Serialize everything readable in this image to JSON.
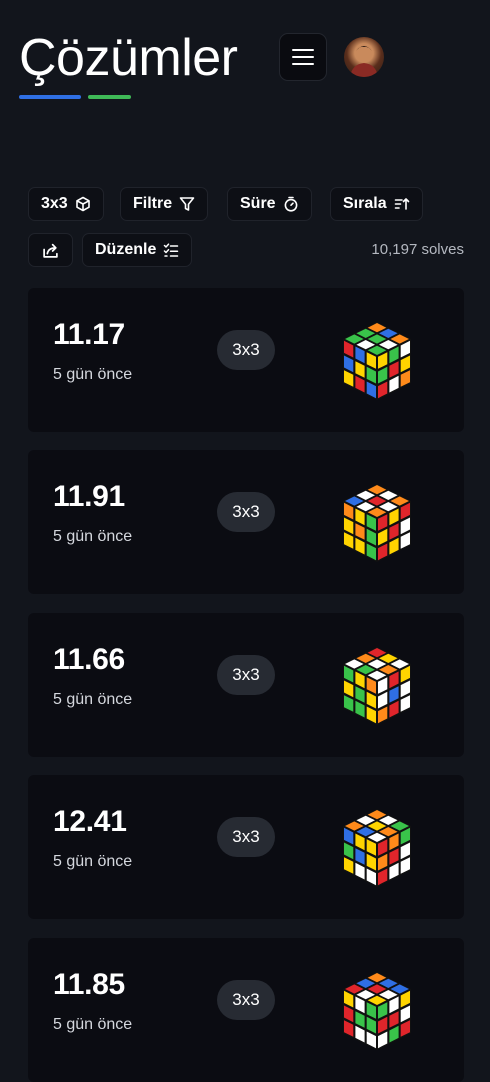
{
  "header": {
    "title": "Çözümler",
    "accent_colors": [
      "#2f6fe4",
      "#3fb957"
    ]
  },
  "toolbar": {
    "puzzle_label": "3x3",
    "filter_label": "Filtre",
    "time_label": "Süre",
    "sort_label": "Sırala",
    "edit_label": "Düzenle",
    "solve_count": "10,197 solves"
  },
  "solves": [
    {
      "time": "11.17",
      "ago": "5 gün önce",
      "puzzle": "3x3",
      "top": [
        "#39c34a",
        "#39c34a",
        "#ff8a1a",
        "#ffffff",
        "#39c34a",
        "#2f6fe4",
        "#39c34a",
        "#ffffff",
        "#ff8a1a"
      ],
      "left": [
        "#e0252b",
        "#2f6fe4",
        "#ffd400",
        "#2f6fe4",
        "#ffd400",
        "#39c34a",
        "#ffd400",
        "#e0252b",
        "#2f6fe4"
      ],
      "right": [
        "#ffd400",
        "#39c34a",
        "#ffffff",
        "#39c34a",
        "#e0252b",
        "#ffd400",
        "#e0252b",
        "#ffffff",
        "#ff8a1a"
      ]
    },
    {
      "time": "11.91",
      "ago": "5 gün önce",
      "puzzle": "3x3",
      "top": [
        "#2f6fe4",
        "#ffffff",
        "#ff8a1a",
        "#ffffff",
        "#e0252b",
        "#ffffff",
        "#ff8a1a",
        "#ffffff",
        "#ff8a1a"
      ],
      "left": [
        "#ff8a1a",
        "#ffd400",
        "#39c34a",
        "#ffd400",
        "#ff8a1a",
        "#39c34a",
        "#ffd400",
        "#ffd400",
        "#39c34a"
      ],
      "right": [
        "#e0252b",
        "#ffd400",
        "#e0252b",
        "#ffd400",
        "#e0252b",
        "#ffffff",
        "#e0252b",
        "#ffd400",
        "#ffffff"
      ]
    },
    {
      "time": "11.66",
      "ago": "5 gün önce",
      "puzzle": "3x3",
      "top": [
        "#ffffff",
        "#ff8a1a",
        "#e0252b",
        "#39c34a",
        "#ffffff",
        "#ffd400",
        "#ffffff",
        "#ff8a1a",
        "#ffffff"
      ],
      "left": [
        "#39c34a",
        "#ffd400",
        "#ff8a1a",
        "#ffd400",
        "#39c34a",
        "#ffd400",
        "#39c34a",
        "#39c34a",
        "#ffd400"
      ],
      "right": [
        "#ffffff",
        "#e0252b",
        "#ffd400",
        "#ffffff",
        "#2f6fe4",
        "#ffffff",
        "#ff8a1a",
        "#e0252b",
        "#ffffff"
      ]
    },
    {
      "time": "12.41",
      "ago": "5 gün önce",
      "puzzle": "3x3",
      "top": [
        "#ff8a1a",
        "#ffffff",
        "#ff8a1a",
        "#2f6fe4",
        "#ffd400",
        "#ffffff",
        "#ffffff",
        "#ff8a1a",
        "#39c34a"
      ],
      "left": [
        "#2f6fe4",
        "#ffd400",
        "#ffd400",
        "#39c34a",
        "#2f6fe4",
        "#ffd400",
        "#ffd400",
        "#ffffff",
        "#ffffff"
      ],
      "right": [
        "#e0252b",
        "#ff8a1a",
        "#39c34a",
        "#ff8a1a",
        "#e0252b",
        "#ffffff",
        "#e0252b",
        "#ffffff",
        "#ffffff"
      ]
    },
    {
      "time": "11.85",
      "ago": "5 gün önce",
      "puzzle": "3x3",
      "top": [
        "#e0252b",
        "#2f6fe4",
        "#ff8a1a",
        "#ffffff",
        "#e0252b",
        "#2f6fe4",
        "#ffd400",
        "#ffffff",
        "#2f6fe4"
      ],
      "left": [
        "#ffd400",
        "#ffffff",
        "#39c34a",
        "#e0252b",
        "#39c34a",
        "#39c34a",
        "#e0252b",
        "#ffffff",
        "#ffffff"
      ],
      "right": [
        "#39c34a",
        "#ffffff",
        "#ffd400",
        "#e0252b",
        "#e0252b",
        "#ffffff",
        "#ffffff",
        "#39c34a",
        "#e0252b"
      ]
    }
  ]
}
